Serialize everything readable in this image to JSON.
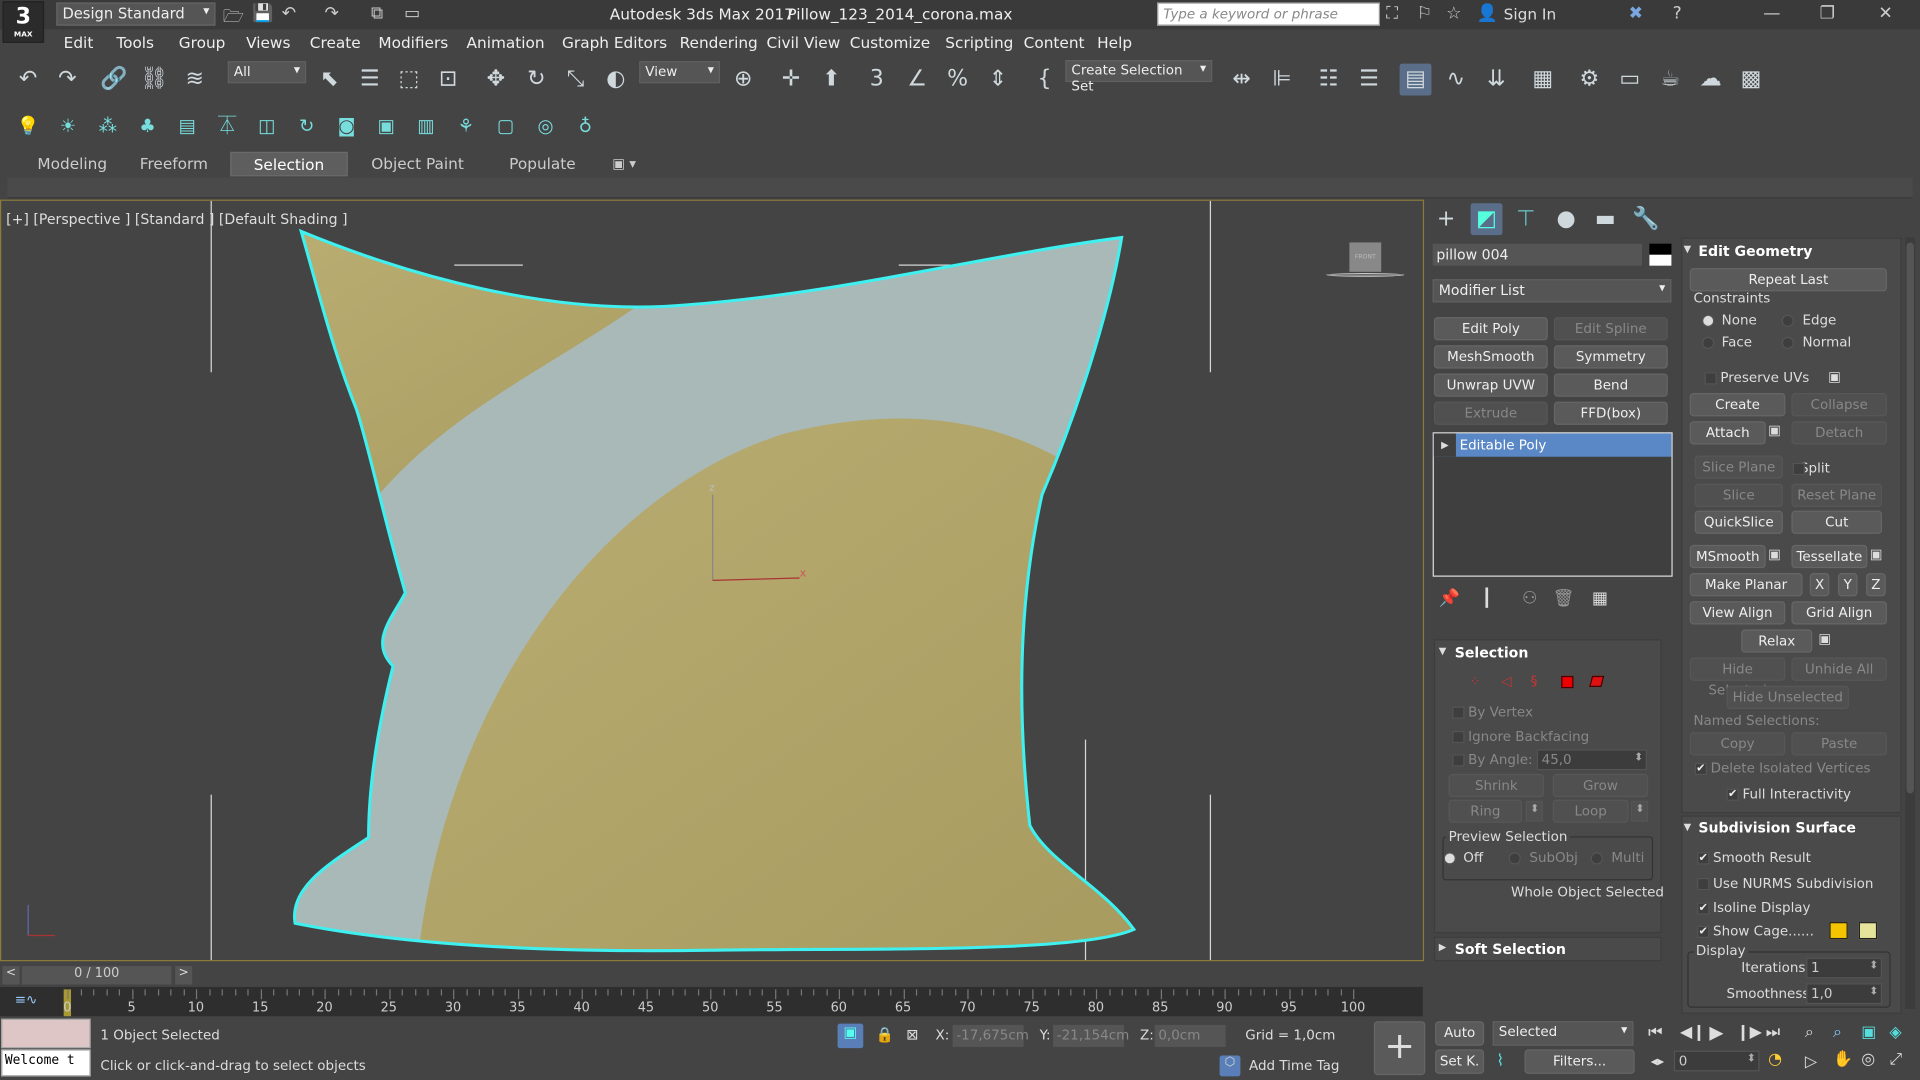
{
  "title_bar": {
    "workspace": "Design Standard",
    "app": "Autodesk 3ds Max 2017",
    "file": "Pillow_123_2014_corona.max",
    "search_placeholder": "Type a keyword or phrase",
    "sign_in": "Sign In",
    "logo": "3",
    "logo_sub": "MAX"
  },
  "menu": [
    "Edit",
    "Tools",
    "Group",
    "Views",
    "Create",
    "Modifiers",
    "Animation",
    "Graph Editors",
    "Rendering",
    "Civil View",
    "Customize",
    "Scripting",
    "Content",
    "Help"
  ],
  "toolbar": {
    "filter": "All",
    "ref_coord": "View",
    "selection_set": "Create Selection Set"
  },
  "ribbon_tabs": [
    "Modeling",
    "Freeform",
    "Selection",
    "Object Paint",
    "Populate"
  ],
  "active_tab": "Selection",
  "viewport": {
    "label": "[+] [Perspective ] [Standard ] [Default Shading ]",
    "viewcube": "FRONT",
    "axis_x": "x",
    "axis_z": "z"
  },
  "command_panel": {
    "object_name": "pillow 004",
    "modifier_list": "Modifier List",
    "modifier_buttons": [
      {
        "label": "Edit Poly",
        "enabled": true
      },
      {
        "label": "Edit Spline",
        "enabled": false
      },
      {
        "label": "MeshSmooth",
        "enabled": true
      },
      {
        "label": "Symmetry",
        "enabled": true
      },
      {
        "label": "Unwrap UVW",
        "enabled": true
      },
      {
        "label": "Bend",
        "enabled": true
      },
      {
        "label": "Extrude",
        "enabled": false
      },
      {
        "label": "FFD(box)",
        "enabled": true
      }
    ],
    "stack_item": "Editable Poly",
    "selection": {
      "title": "Selection",
      "by_vertex": "By Vertex",
      "ignore_backfacing": "Ignore Backfacing",
      "by_angle": "By Angle:",
      "angle": "45,0",
      "shrink": "Shrink",
      "grow": "Grow",
      "ring": "Ring",
      "loop": "Loop",
      "preview": "Preview Selection",
      "off": "Off",
      "subobj": "SubObj",
      "multi": "Multi",
      "status": "Whole Object Selected"
    },
    "soft_selection": "Soft Selection",
    "edit_geometry": {
      "title": "Edit Geometry",
      "repeat_last": "Repeat Last",
      "constraints": "Constraints",
      "none": "None",
      "edge": "Edge",
      "face": "Face",
      "normal": "Normal",
      "preserve_uvs": "Preserve UVs",
      "create": "Create",
      "collapse": "Collapse",
      "attach": "Attach",
      "detach": "Detach",
      "slice_plane": "Slice Plane",
      "split": "Split",
      "slice": "Slice",
      "reset_plane": "Reset Plane",
      "quickslice": "QuickSlice",
      "cut": "Cut",
      "msmooth": "MSmooth",
      "tessellate": "Tessellate",
      "make_planar": "Make Planar",
      "x": "X",
      "y": "Y",
      "z": "Z",
      "view_align": "View Align",
      "grid_align": "Grid Align",
      "relax": "Relax",
      "hide_selected": "Hide Selected",
      "unhide_all": "Unhide All",
      "hide_unselected": "Hide Unselected",
      "named_selections": "Named Selections:",
      "copy": "Copy",
      "paste": "Paste",
      "delete_isolated": "Delete Isolated Vertices",
      "full_interactivity": "Full Interactivity"
    },
    "subdivision": {
      "title": "Subdivision Surface",
      "smooth_result": "Smooth Result",
      "use_nurms": "Use NURMS Subdivision",
      "isoline": "Isoline Display",
      "show_cage": "Show Cage......",
      "display": "Display",
      "iterations_label": "Iterations:",
      "iterations": "1",
      "smoothness_label": "Smoothness:",
      "smoothness": "1,0",
      "cage_color1": "#f5c400",
      "cage_color2": "#e6e39a"
    }
  },
  "timeline": {
    "frame": "0 / 100",
    "ticks": [
      "0",
      "5",
      "10",
      "15",
      "20",
      "25",
      "30",
      "35",
      "40",
      "45",
      "50",
      "55",
      "60",
      "65",
      "70",
      "75",
      "80",
      "85",
      "90",
      "95",
      "100"
    ]
  },
  "status": {
    "maxscript": "Welcome t",
    "selected": "1 Object Selected",
    "prompt": "Click or click-and-drag to select objects",
    "x_label": "X:",
    "x": "-17,675cm",
    "y_label": "Y:",
    "y": "-21,154cm",
    "z_label": "Z:",
    "z": "0,0cm",
    "grid": "Grid = 1,0cm",
    "add_time_tag": "Add Time Tag",
    "auto": "Auto",
    "set_key": "Set K.",
    "key_mode": "Selected",
    "filters": "Filters...",
    "current_frame": "0"
  },
  "colors": {
    "accent": "#5a7fb8",
    "selection_outline": "#3ff0f0",
    "viewport_border": "#8b7b3b"
  }
}
